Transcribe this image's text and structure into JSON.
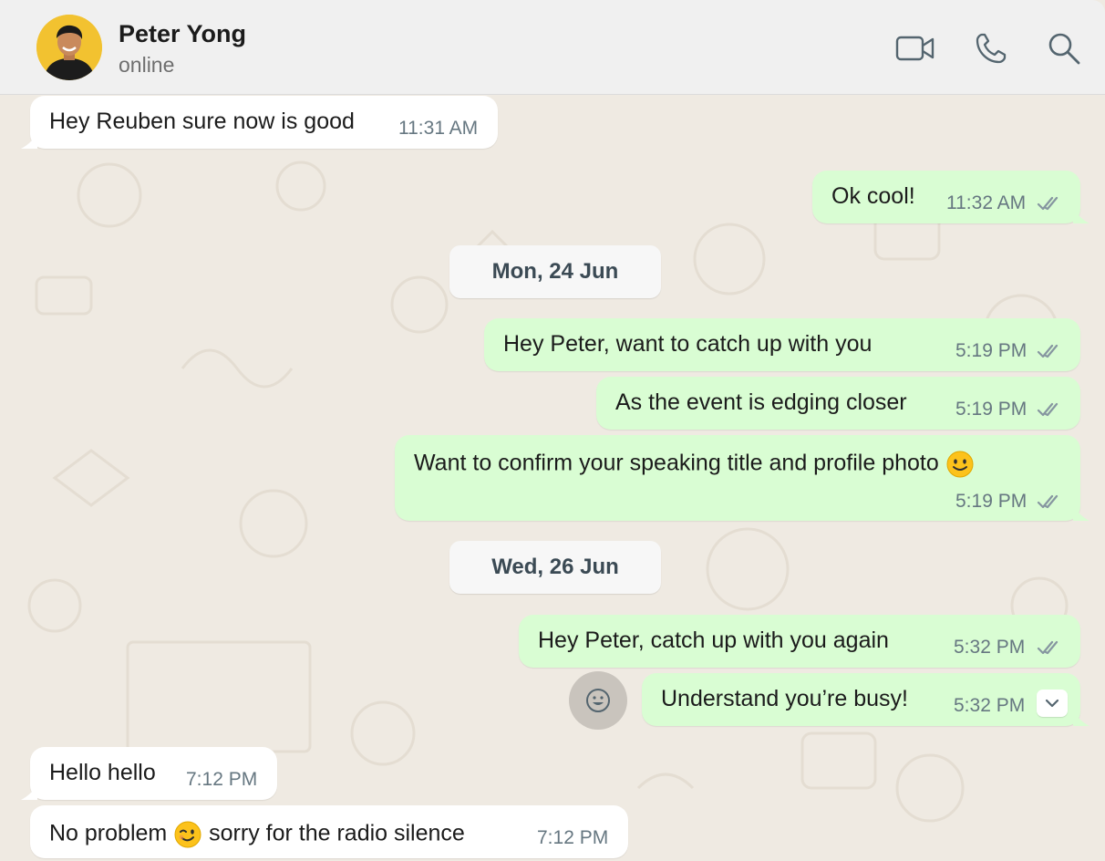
{
  "header": {
    "contact_name": "Peter Yong",
    "status": "online",
    "icons": [
      "video-call-icon",
      "voice-call-icon",
      "search-icon"
    ]
  },
  "date_separators": [
    "Mon, 24 Jun",
    "Wed, 26 Jun"
  ],
  "messages": [
    {
      "direction": "incoming",
      "text": "Hey Reuben sure now is good",
      "time": "11:31 AM"
    },
    {
      "direction": "outgoing",
      "text": "Ok cool!",
      "time": "11:32 AM",
      "status": "read"
    },
    {
      "direction": "outgoing",
      "text": "Hey Peter, want to catch up with you",
      "time": "5:19 PM",
      "status": "read"
    },
    {
      "direction": "outgoing",
      "text": "As the event is edging closer",
      "time": "5:19 PM",
      "status": "read"
    },
    {
      "direction": "outgoing",
      "text": "Want to confirm your speaking title and profile photo",
      "emoji": "🙂",
      "time": "5:19 PM",
      "status": "read"
    },
    {
      "direction": "outgoing",
      "text": "Hey Peter, catch up with you again",
      "time": "5:32 PM",
      "status": "read"
    },
    {
      "direction": "outgoing",
      "text": "Understand you’re busy!",
      "time": "5:32 PM"
    },
    {
      "direction": "incoming",
      "text": "Hello hello",
      "time": "7:12 PM"
    },
    {
      "direction": "incoming",
      "text_before": "No problem",
      "emoji": "😉",
      "text_after": "sorry for the radio silence",
      "time": "7:12 PM"
    }
  ],
  "colors": {
    "header_bg": "#f0f0f0",
    "chat_bg": "#efeae2",
    "incoming_bubble": "#ffffff",
    "outgoing_bubble": "#d9fdd3",
    "timestamp": "#667781",
    "read_ticks": "#8696a0",
    "avatar_bg": "#f2c230"
  }
}
